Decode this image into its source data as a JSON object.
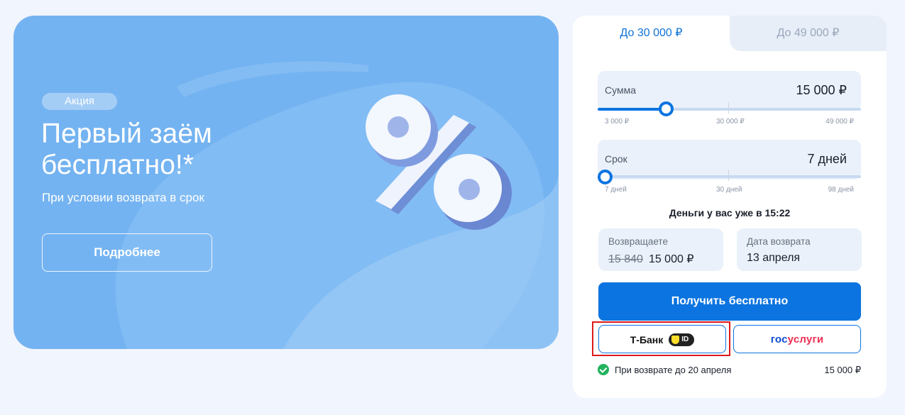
{
  "banner": {
    "badge": "Акция",
    "title": "Первый заём бесплатно!*",
    "subtitle": "При условии возврата в срок",
    "details_button": "Подробнее",
    "art_icon": "percent-3d-icon"
  },
  "calculator": {
    "tabs": [
      {
        "label": "До 30 000 ₽",
        "active": true
      },
      {
        "label": "До 49 000 ₽",
        "active": false
      }
    ],
    "amount": {
      "label": "Сумма",
      "value": "15 000 ₽",
      "min_label": "3 000 ₽",
      "mid_label": "30 000 ₽",
      "max_label": "49 000 ₽",
      "position_fraction": 0.26
    },
    "term": {
      "label": "Срок",
      "value": "7 дней",
      "min_label": "7 дней",
      "mid_label": "30 дней",
      "max_label": "98 дней",
      "position_fraction": 0.0
    },
    "delivery_text": "Деньги у вас уже в 15:22",
    "return_card": {
      "label": "Возвращаете",
      "old_amount": "15 840",
      "new_amount": "15 000 ₽"
    },
    "date_card": {
      "label": "Дата возврата",
      "value": "13 апреля"
    },
    "get_button": "Получить бесплатно",
    "tbank_button": {
      "label": "Т-Банк",
      "badge": "ID"
    },
    "gosuslugi_button": {
      "part1": "гос",
      "part2": "услуги"
    },
    "footer": {
      "note": "При возврате до 20 апреля",
      "sum": "15 000 ₽"
    }
  },
  "colors": {
    "page_bg": "#f1f5fd",
    "banner_bg": "#74b3f1",
    "accent": "#0b74e0",
    "highlight": "#dd1a1a",
    "success": "#22b35e"
  }
}
